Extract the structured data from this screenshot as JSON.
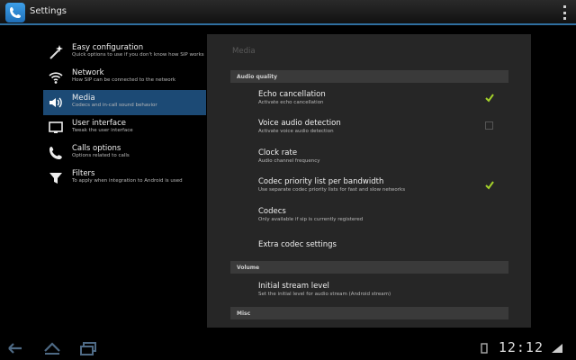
{
  "actionbar": {
    "title": "Settings"
  },
  "headers": [
    {
      "title": "Easy configuration",
      "summary": "Quick options to use if you don't know how SIP works",
      "icon": "magic-wand-icon",
      "active": false
    },
    {
      "title": "Network",
      "summary": "How SIP can be connected to the network",
      "icon": "wifi-icon",
      "active": false
    },
    {
      "title": "Media",
      "summary": "Codecs and in-call sound behavior",
      "icon": "speaker-icon",
      "active": true
    },
    {
      "title": "User interface",
      "summary": "Tweak the user interface",
      "icon": "monitor-icon",
      "active": false
    },
    {
      "title": "Calls options",
      "summary": "Options related to calls",
      "icon": "phone-icon",
      "active": false
    },
    {
      "title": "Filters",
      "summary": "To apply when integration to Android is used",
      "icon": "filter-icon",
      "active": false
    }
  ],
  "panel": {
    "title": "Media",
    "categories": {
      "audio_quality": "Audio quality",
      "volume": "Volume",
      "misc": "Misc"
    },
    "prefs": [
      {
        "title": "Echo cancellation",
        "summary": "Activate echo cancellation",
        "checkbox": "checked"
      },
      {
        "title": "Voice audio detection",
        "summary": "Activate voice audio detection",
        "checkbox": "unchecked"
      },
      {
        "title": "Clock rate",
        "summary": "Audio channel frequency",
        "checkbox": "none"
      },
      {
        "title": "Codec priority list per bandwidth",
        "summary": "Use separate codec priority lists for fast and slow networks",
        "checkbox": "checked"
      },
      {
        "title": "Codecs",
        "summary": "Only available if sip is currently registered",
        "checkbox": "none"
      },
      {
        "title": "Extra codec settings",
        "summary": "",
        "checkbox": "none"
      },
      {
        "title": "Initial stream level",
        "summary": "Set the initial level for audio stream (Android stream)",
        "checkbox": "none"
      }
    ]
  },
  "sysbar": {
    "clock": "12:12"
  },
  "colors": {
    "accent": "#2f6fa0",
    "selected": "#1c4a75",
    "check": "#a4d12a"
  }
}
